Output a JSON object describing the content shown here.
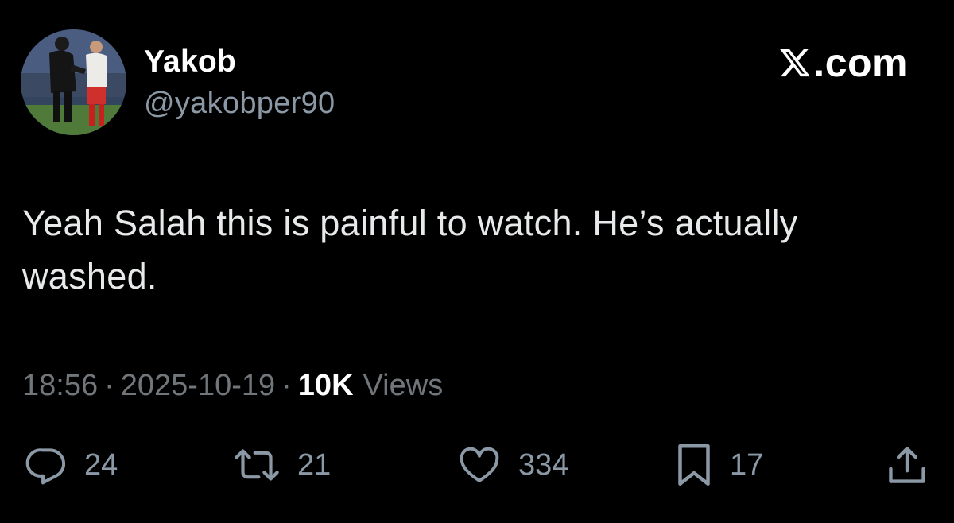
{
  "author": {
    "name": "Yakob",
    "handle": "@yakobper90"
  },
  "brand": {
    "logo_icon": "x-logo-icon",
    "text": ".com"
  },
  "tweet": {
    "text": "Yeah Salah this is painful to watch. He’s actually washed."
  },
  "meta": {
    "time": "18:56",
    "separator": "·",
    "date": "2025-10-19",
    "views_count": "10K",
    "views_label": "Views"
  },
  "actions": {
    "reply": {
      "icon": "reply-icon",
      "count": "24"
    },
    "repost": {
      "icon": "repost-icon",
      "count": "21"
    },
    "like": {
      "icon": "heart-icon",
      "count": "334"
    },
    "bookmark": {
      "icon": "bookmark-icon",
      "count": "17"
    },
    "share": {
      "icon": "share-icon"
    }
  },
  "colors": {
    "background": "#000000",
    "primary_text": "#e7e9ea",
    "secondary_text": "#71767b",
    "name_text": "#ffffff"
  }
}
